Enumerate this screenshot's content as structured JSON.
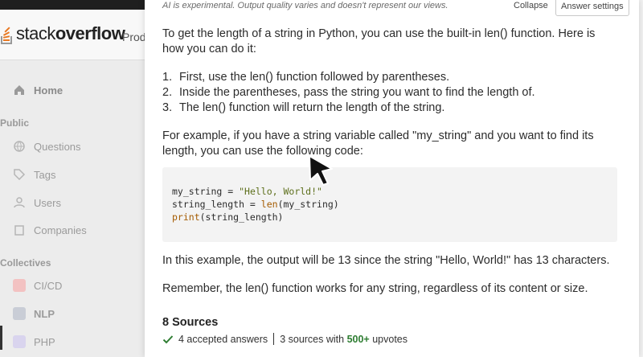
{
  "background": {
    "logo": {
      "prefix": "stack",
      "suffix": "overflow"
    },
    "header": {
      "products_label": "Prod"
    },
    "sidebar": {
      "home": "Home",
      "public_heading": "Public",
      "items": [
        "Questions",
        "Tags",
        "Users",
        "Companies"
      ],
      "collectives_heading": "Collectives",
      "collectives": [
        "CI/CD",
        "NLP",
        "PHP"
      ]
    }
  },
  "panel": {
    "disclaimer": "AI is experimental. Output quality varies and doesn't represent our views.",
    "collapse_label": "Collapse",
    "settings_label": "Answer settings",
    "intro": "To get the length of a string in Python, you can use the built-in len() function. Here is how you can do it:",
    "steps": [
      {
        "num": "1.",
        "text": "First, use the len() function followed by parentheses."
      },
      {
        "num": "2.",
        "text": "Inside the parentheses, pass the string you want to find the length of."
      },
      {
        "num": "3.",
        "text": "The len() function will return the length of the string."
      }
    ],
    "example_intro": "For example, if you have a string variable called \"my_string\" and you want to find its length, you can use the following code:",
    "code": {
      "line1_var": "my_string = ",
      "line1_str": "\"Hello, World!\"",
      "line2_a": "string_length = ",
      "line2_fn": "len",
      "line2_b": "(my_string)",
      "line3_fn": "print",
      "line3_b": "(string_length)"
    },
    "result": "In this example, the output will be 13 since the string \"Hello, World!\" has 13 characters.",
    "remember": "Remember, the len() function works for any string, regardless of its content or size.",
    "sources": {
      "title": "8 Sources",
      "accepted": "4 accepted answers",
      "with_prefix": "3 sources with",
      "upvotes_count": "500+",
      "upvotes_suffix": "upvotes"
    }
  },
  "colors": {
    "accent_orange": "#e87822",
    "upvote_green": "#2e7d32",
    "code_bg": "#f3f3f3"
  }
}
